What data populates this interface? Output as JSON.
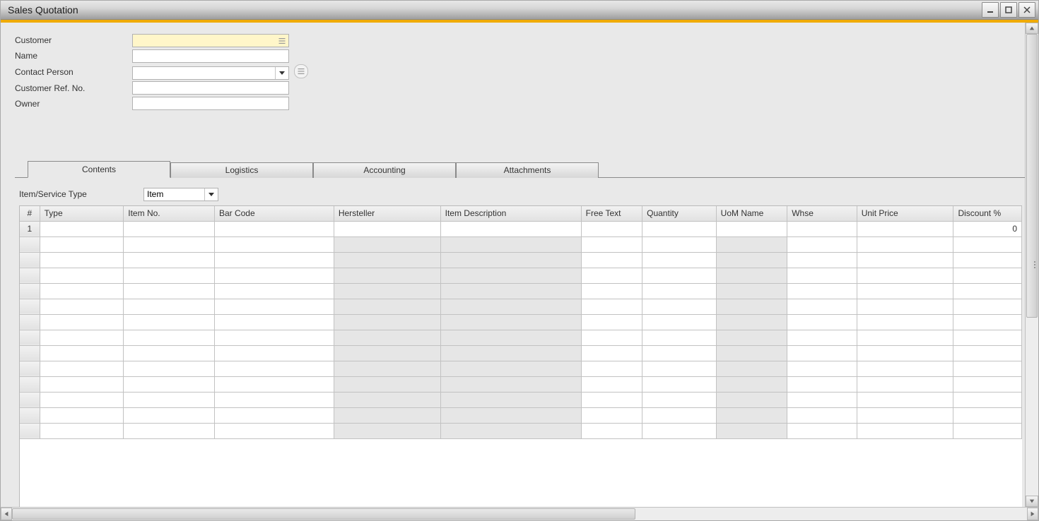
{
  "window": {
    "title": "Sales Quotation"
  },
  "header": {
    "customer_label": "Customer",
    "customer_value": "",
    "name_label": "Name",
    "name_value": "",
    "contact_label": "Contact Person",
    "contact_value": "",
    "custref_label": "Customer Ref. No.",
    "custref_value": "",
    "owner_label": "Owner",
    "owner_value": ""
  },
  "tabs": {
    "contents": "Contents",
    "logistics": "Logistics",
    "accounting": "Accounting",
    "attachments": "Attachments",
    "active": "contents"
  },
  "contents": {
    "ist_label": "Item/Service Type",
    "ist_value": "Item",
    "columns": {
      "rownum": "#",
      "type": "Type",
      "itemno": "Item No.",
      "barcode": "Bar Code",
      "hersteller": "Hersteller",
      "itemdesc": "Item Description",
      "freetext": "Free Text",
      "quantity": "Quantity",
      "uomname": "UoM Name",
      "whse": "Whse",
      "unitprice": "Unit Price",
      "discountpct": "Discount %"
    },
    "rows": [
      {
        "num": "1",
        "discountpct": "0"
      }
    ],
    "blank_row_count": 13
  }
}
